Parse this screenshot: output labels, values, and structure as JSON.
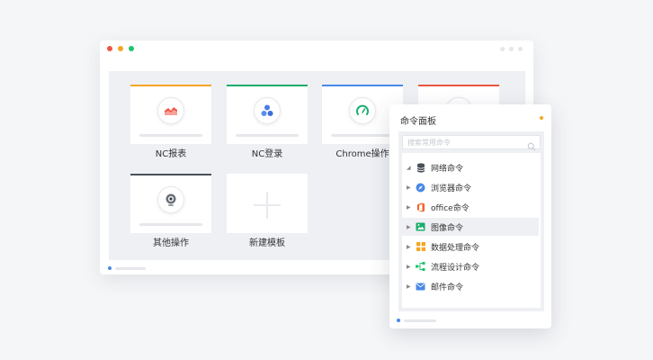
{
  "window": {
    "title_dots": [
      "#f0564a",
      "#f5a623",
      "#1fc36b"
    ],
    "cards": [
      {
        "label": "NC报表",
        "accent": "#f5a623",
        "icon": "chart-area-icon"
      },
      {
        "label": "NC登录",
        "accent": "#1aad6b",
        "icon": "users-icon"
      },
      {
        "label": "Chrome操作",
        "accent": "#4a88e8",
        "icon": "chrome-gauge-icon"
      },
      {
        "label": "",
        "accent": "#e8573e",
        "icon": "partial-card-icon"
      },
      {
        "label": "其他操作",
        "accent": "#4a505a",
        "icon": "webcam-icon"
      },
      {
        "label": "新建模板",
        "accent": "",
        "icon": "plus-icon"
      }
    ]
  },
  "panel": {
    "title": "命令面板",
    "status_color": "#f5a623",
    "search": {
      "placeholder": "搜索常用命令"
    },
    "tree": [
      {
        "label": "网络命令",
        "icon": "database-icon",
        "expanded": true
      },
      {
        "label": "浏览器命令",
        "icon": "compass-icon",
        "expanded": false
      },
      {
        "label": "office命令",
        "icon": "office-icon",
        "expanded": false
      },
      {
        "label": "图像命令",
        "icon": "image-icon",
        "expanded": false,
        "selected": true
      },
      {
        "label": "数据处理命令",
        "icon": "grid-icon",
        "expanded": false
      },
      {
        "label": "流程设计命令",
        "icon": "flow-icon",
        "expanded": false
      },
      {
        "label": "邮件命令",
        "icon": "mail-icon",
        "expanded": false
      }
    ]
  }
}
